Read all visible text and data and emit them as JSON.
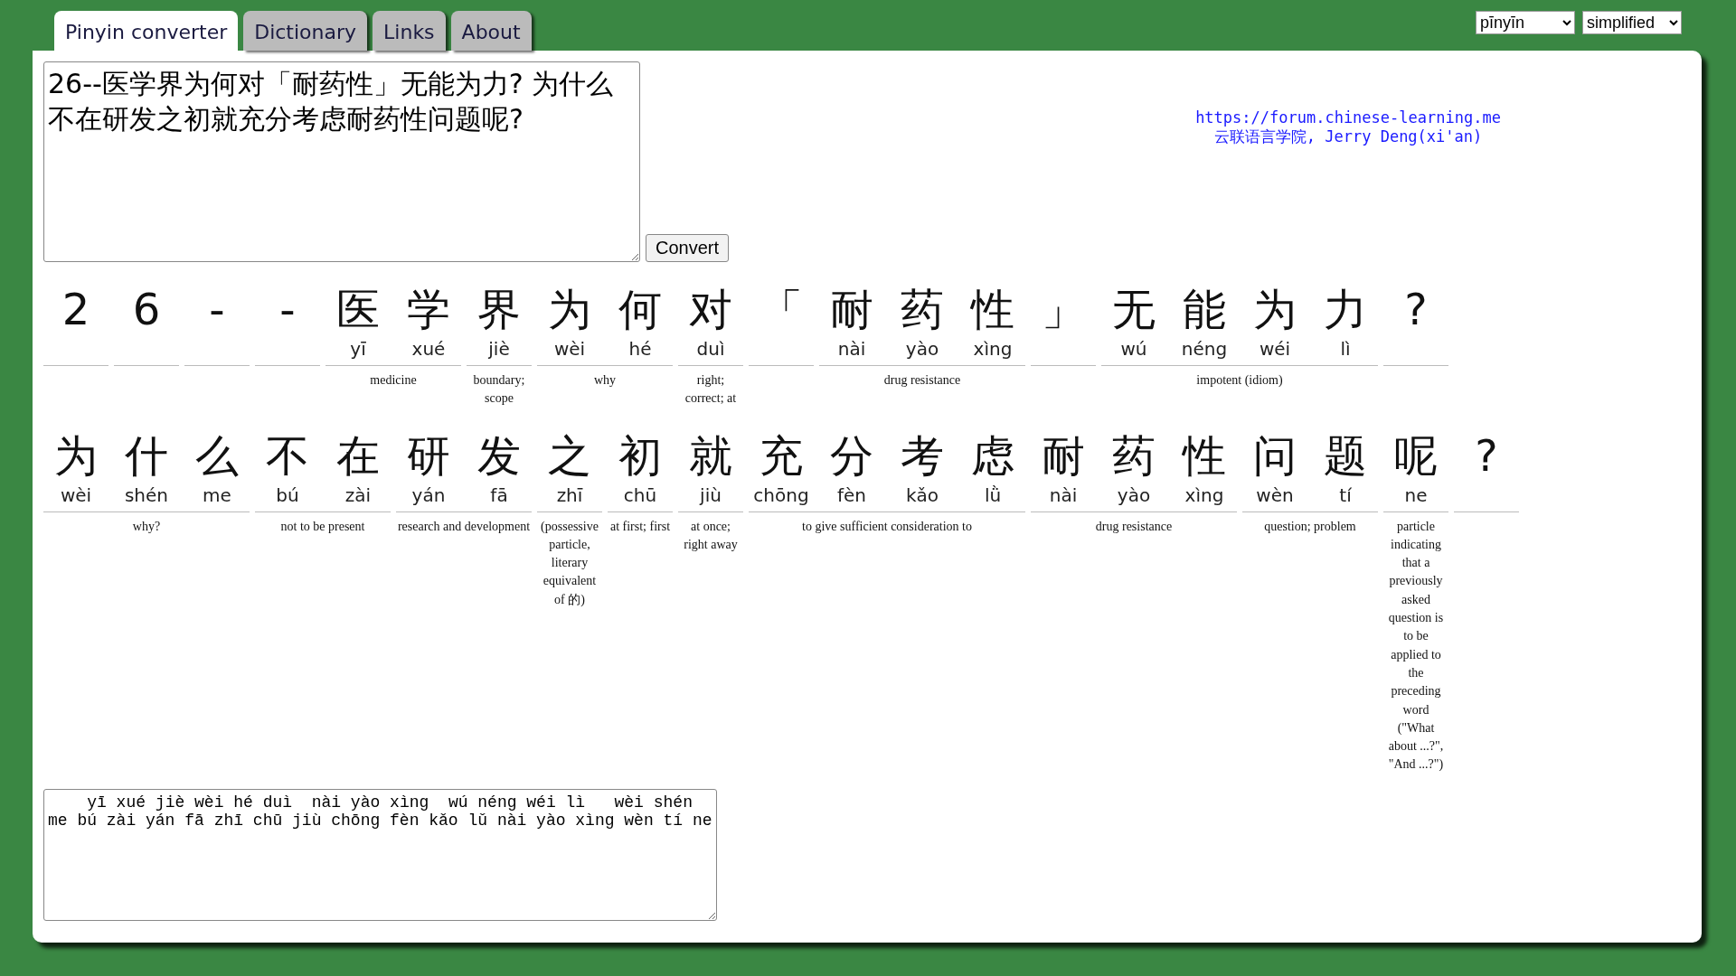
{
  "tabs": [
    {
      "label": "Pinyin converter",
      "selected": true
    },
    {
      "label": "Dictionary",
      "selected": false
    },
    {
      "label": "Links",
      "selected": false
    },
    {
      "label": "About",
      "selected": false
    }
  ],
  "selects": [
    {
      "value": "pīnyīn"
    },
    {
      "value": "simplified"
    }
  ],
  "input": {
    "value": "26--医学界为何对「耐药性」无能为力? 为什么不在研发之初就充分考虑耐药性问题呢?"
  },
  "convert_button": "Convert",
  "credit": {
    "link": "https://forum.chinese-learning.me",
    "line": "云联语言学院, Jerry Deng(xi'an)"
  },
  "lines": [
    [
      {
        "chars": [
          {
            "hanzi": "2"
          }
        ]
      },
      {
        "chars": [
          {
            "hanzi": "6"
          }
        ]
      },
      {
        "chars": [
          {
            "hanzi": "-"
          }
        ]
      },
      {
        "chars": [
          {
            "hanzi": "-"
          }
        ]
      },
      {
        "chars": [
          {
            "hanzi": "医",
            "pinyin": "yī"
          },
          {
            "hanzi": "学",
            "pinyin": "xué"
          }
        ],
        "definition": "medicine"
      },
      {
        "chars": [
          {
            "hanzi": "界",
            "pinyin": "jiè"
          }
        ],
        "definition": "boundary; scope"
      },
      {
        "chars": [
          {
            "hanzi": "为",
            "pinyin": "wèi"
          },
          {
            "hanzi": "何",
            "pinyin": "hé"
          }
        ],
        "definition": "why"
      },
      {
        "chars": [
          {
            "hanzi": "对",
            "pinyin": "duì"
          }
        ],
        "definition": "right; correct; at"
      },
      {
        "chars": [
          {
            "hanzi": "「"
          }
        ]
      },
      {
        "chars": [
          {
            "hanzi": "耐",
            "pinyin": "nài"
          },
          {
            "hanzi": "药",
            "pinyin": "yào"
          },
          {
            "hanzi": "性",
            "pinyin": "xìng"
          }
        ],
        "definition": "drug resistance"
      },
      {
        "chars": [
          {
            "hanzi": "」"
          }
        ]
      },
      {
        "chars": [
          {
            "hanzi": "无",
            "pinyin": "wú"
          },
          {
            "hanzi": "能",
            "pinyin": "néng"
          },
          {
            "hanzi": "为",
            "pinyin": "wéi"
          },
          {
            "hanzi": "力",
            "pinyin": "lì"
          }
        ],
        "definition": "impotent (idiom)"
      },
      {
        "chars": [
          {
            "hanzi": "?"
          }
        ]
      }
    ],
    [
      {
        "chars": [
          {
            "hanzi": "为",
            "pinyin": "wèi"
          },
          {
            "hanzi": "什",
            "pinyin": "shén"
          },
          {
            "hanzi": "么",
            "pinyin": "me"
          }
        ],
        "definition": "why?"
      },
      {
        "chars": [
          {
            "hanzi": "不",
            "pinyin": "bú"
          },
          {
            "hanzi": "在",
            "pinyin": "zài"
          }
        ],
        "definition": "not to be present"
      },
      {
        "chars": [
          {
            "hanzi": "研",
            "pinyin": "yán"
          },
          {
            "hanzi": "发",
            "pinyin": "fā"
          }
        ],
        "definition": "research and development"
      },
      {
        "chars": [
          {
            "hanzi": "之",
            "pinyin": "zhī"
          }
        ],
        "definition": "(possessive particle, literary equivalent of 的)"
      },
      {
        "chars": [
          {
            "hanzi": "初",
            "pinyin": "chū"
          }
        ],
        "definition": "at first; first"
      },
      {
        "chars": [
          {
            "hanzi": "就",
            "pinyin": "jiù"
          }
        ],
        "definition": "at once; right away"
      },
      {
        "chars": [
          {
            "hanzi": "充",
            "pinyin": "chōng"
          },
          {
            "hanzi": "分",
            "pinyin": "fèn"
          },
          {
            "hanzi": "考",
            "pinyin": "kǎo"
          },
          {
            "hanzi": "虑",
            "pinyin": "lǜ"
          }
        ],
        "definition": "to give sufficient consideration to"
      },
      {
        "chars": [
          {
            "hanzi": "耐",
            "pinyin": "nài"
          },
          {
            "hanzi": "药",
            "pinyin": "yào"
          },
          {
            "hanzi": "性",
            "pinyin": "xìng"
          }
        ],
        "definition": "drug resistance"
      },
      {
        "chars": [
          {
            "hanzi": "问",
            "pinyin": "wèn"
          },
          {
            "hanzi": "题",
            "pinyin": "tí"
          }
        ],
        "definition": "question; problem"
      },
      {
        "chars": [
          {
            "hanzi": "呢",
            "pinyin": "ne"
          }
        ],
        "definition": "particle indicating that a previously asked question is to be applied to the preceding word (\"What about ...?\", \"And ...?\")"
      },
      {
        "chars": [
          {
            "hanzi": "?"
          }
        ]
      }
    ]
  ],
  "output": {
    "value": "    yī xué jiè wèi hé duì  nài yào xìng  wú néng wéi lì   wèi shén me bú zài yán fā zhī chū jiù chōng fèn kǎo lǔ nài yào xìng wèn tí ne"
  }
}
